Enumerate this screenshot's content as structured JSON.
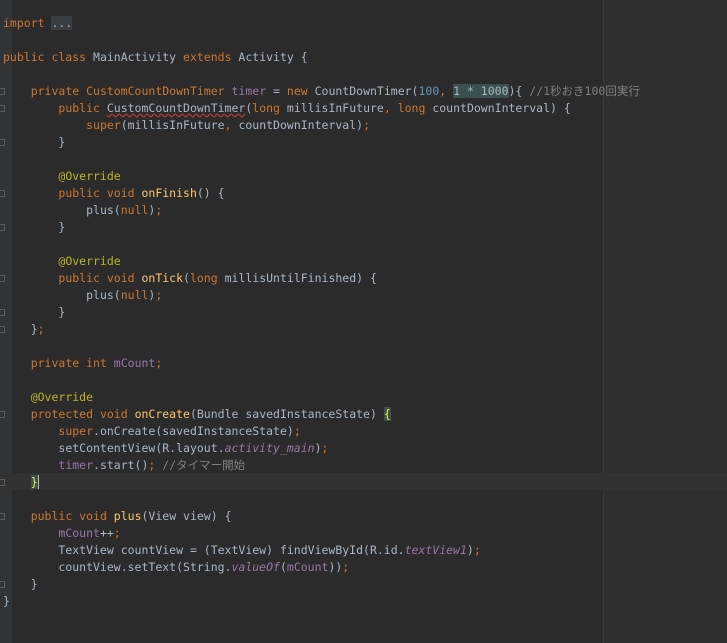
{
  "editor": {
    "theme_colors": {
      "background": "#2b2b2b",
      "keyword": "#cc7832",
      "method": "#ffc66d",
      "number": "#6897bb",
      "comment": "#808080",
      "annotation": "#bbb529",
      "field": "#9876aa",
      "text": "#a9b7c6"
    },
    "lines": [
      {
        "indent": "",
        "tokens": [
          {
            "t": "import ",
            "c": "kw"
          },
          {
            "t": "...",
            "c": "fold-text"
          }
        ]
      },
      {
        "indent": "",
        "tokens": []
      },
      {
        "indent": "",
        "tokens": [
          {
            "t": "public class ",
            "c": "kw"
          },
          {
            "t": "MainActivity ",
            "c": ""
          },
          {
            "t": "extends ",
            "c": "kw"
          },
          {
            "t": "Activity {",
            "c": ""
          }
        ]
      },
      {
        "indent": "",
        "tokens": []
      },
      {
        "indent": "    ",
        "tokens": [
          {
            "t": "private ",
            "c": "kw"
          },
          {
            "t": "CustomCountDownTimer ",
            "c": "kw"
          },
          {
            "t": "timer",
            "c": "fld"
          },
          {
            "t": " = ",
            "c": ""
          },
          {
            "t": "new ",
            "c": "kw"
          },
          {
            "t": "CountDownTimer(",
            "c": ""
          },
          {
            "t": "100",
            "c": "num"
          },
          {
            "t": ", ",
            "c": "kw"
          },
          {
            "t": "1 * 1000",
            "c": "mark"
          },
          {
            "t": "){ ",
            "c": ""
          },
          {
            "t": "//1秒おき100回実行",
            "c": "cm"
          }
        ]
      },
      {
        "indent": "        ",
        "tokens": [
          {
            "t": "public ",
            "c": "kw"
          },
          {
            "t": "CustomCountDownTimer",
            "c": "squig"
          },
          {
            "t": "(",
            "c": ""
          },
          {
            "t": "long ",
            "c": "kw"
          },
          {
            "t": "millisInFuture",
            "c": ""
          },
          {
            "t": ", ",
            "c": "kw"
          },
          {
            "t": "long ",
            "c": "kw"
          },
          {
            "t": "countDownInterval) {",
            "c": ""
          }
        ]
      },
      {
        "indent": "            ",
        "tokens": [
          {
            "t": "super",
            "c": "kw"
          },
          {
            "t": "(millisInFuture",
            "c": ""
          },
          {
            "t": ", ",
            "c": "kw"
          },
          {
            "t": "countDownInterval)",
            "c": ""
          },
          {
            "t": ";",
            "c": "kw"
          }
        ]
      },
      {
        "indent": "        ",
        "tokens": [
          {
            "t": "}",
            "c": ""
          }
        ]
      },
      {
        "indent": "",
        "tokens": []
      },
      {
        "indent": "        ",
        "tokens": [
          {
            "t": "@Override",
            "c": "an"
          }
        ]
      },
      {
        "indent": "        ",
        "tokens": [
          {
            "t": "public void ",
            "c": "kw"
          },
          {
            "t": "onFinish",
            "c": "fn"
          },
          {
            "t": "() {",
            "c": ""
          }
        ]
      },
      {
        "indent": "            ",
        "tokens": [
          {
            "t": "plus(",
            "c": ""
          },
          {
            "t": "null",
            "c": "kw"
          },
          {
            "t": ")",
            "c": ""
          },
          {
            "t": ";",
            "c": "kw"
          }
        ]
      },
      {
        "indent": "        ",
        "tokens": [
          {
            "t": "}",
            "c": ""
          }
        ]
      },
      {
        "indent": "",
        "tokens": []
      },
      {
        "indent": "        ",
        "tokens": [
          {
            "t": "@Override",
            "c": "an"
          }
        ]
      },
      {
        "indent": "        ",
        "tokens": [
          {
            "t": "public void ",
            "c": "kw"
          },
          {
            "t": "onTick",
            "c": "fn"
          },
          {
            "t": "(",
            "c": ""
          },
          {
            "t": "long ",
            "c": "kw"
          },
          {
            "t": "millisUntilFinished) {",
            "c": ""
          }
        ]
      },
      {
        "indent": "            ",
        "tokens": [
          {
            "t": "plus(",
            "c": ""
          },
          {
            "t": "null",
            "c": "kw"
          },
          {
            "t": ")",
            "c": ""
          },
          {
            "t": ";",
            "c": "kw"
          }
        ]
      },
      {
        "indent": "        ",
        "tokens": [
          {
            "t": "}",
            "c": ""
          }
        ]
      },
      {
        "indent": "    ",
        "tokens": [
          {
            "t": "}",
            "c": ""
          },
          {
            "t": ";",
            "c": "kw"
          }
        ]
      },
      {
        "indent": "",
        "tokens": []
      },
      {
        "indent": "    ",
        "tokens": [
          {
            "t": "private int ",
            "c": "kw"
          },
          {
            "t": "mCount",
            "c": "fld"
          },
          {
            "t": ";",
            "c": "kw"
          }
        ]
      },
      {
        "indent": "",
        "tokens": []
      },
      {
        "indent": "    ",
        "tokens": [
          {
            "t": "@Override",
            "c": "an"
          }
        ]
      },
      {
        "indent": "    ",
        "tokens": [
          {
            "t": "protected void ",
            "c": "kw"
          },
          {
            "t": "onCreate",
            "c": "fn"
          },
          {
            "t": "(Bundle savedInstanceState) ",
            "c": ""
          },
          {
            "t": "{",
            "c": "brace"
          }
        ]
      },
      {
        "indent": "        ",
        "tokens": [
          {
            "t": "super",
            "c": "kw"
          },
          {
            "t": ".onCreate(savedInstanceState)",
            "c": ""
          },
          {
            "t": ";",
            "c": "kw"
          }
        ]
      },
      {
        "indent": "        ",
        "tokens": [
          {
            "t": "setContentView(R.layout.",
            "c": ""
          },
          {
            "t": "activity_main",
            "c": "st"
          },
          {
            "t": ")",
            "c": ""
          },
          {
            "t": ";",
            "c": "kw"
          }
        ]
      },
      {
        "indent": "        ",
        "tokens": [
          {
            "t": "timer",
            "c": "fld"
          },
          {
            "t": ".start()",
            "c": ""
          },
          {
            "t": "; ",
            "c": "kw"
          },
          {
            "t": "//タイマー開始",
            "c": "cm"
          }
        ]
      },
      {
        "indent": "    ",
        "tokens": [
          {
            "t": "}",
            "c": "brace caret"
          }
        ]
      },
      {
        "indent": "",
        "tokens": []
      },
      {
        "indent": "    ",
        "tokens": [
          {
            "t": "public void ",
            "c": "kw"
          },
          {
            "t": "plus",
            "c": "fn"
          },
          {
            "t": "(View view) {",
            "c": ""
          }
        ]
      },
      {
        "indent": "        ",
        "tokens": [
          {
            "t": "mCount",
            "c": "fld"
          },
          {
            "t": "++",
            "c": ""
          },
          {
            "t": ";",
            "c": "kw"
          }
        ]
      },
      {
        "indent": "        ",
        "tokens": [
          {
            "t": "TextView countView = (TextView) findViewById(R.id.",
            "c": ""
          },
          {
            "t": "textView1",
            "c": "st"
          },
          {
            "t": ")",
            "c": ""
          },
          {
            "t": ";",
            "c": "kw"
          }
        ]
      },
      {
        "indent": "        ",
        "tokens": [
          {
            "t": "countView.setText(String.",
            "c": ""
          },
          {
            "t": "valueOf",
            "c": "st"
          },
          {
            "t": "(",
            "c": ""
          },
          {
            "t": "mCount",
            "c": "fld"
          },
          {
            "t": "))",
            "c": ""
          },
          {
            "t": ";",
            "c": "kw"
          }
        ]
      },
      {
        "indent": "    ",
        "tokens": [
          {
            "t": "}",
            "c": ""
          }
        ]
      },
      {
        "indent": "",
        "tokens": [
          {
            "t": "}",
            "c": ""
          }
        ]
      }
    ]
  }
}
